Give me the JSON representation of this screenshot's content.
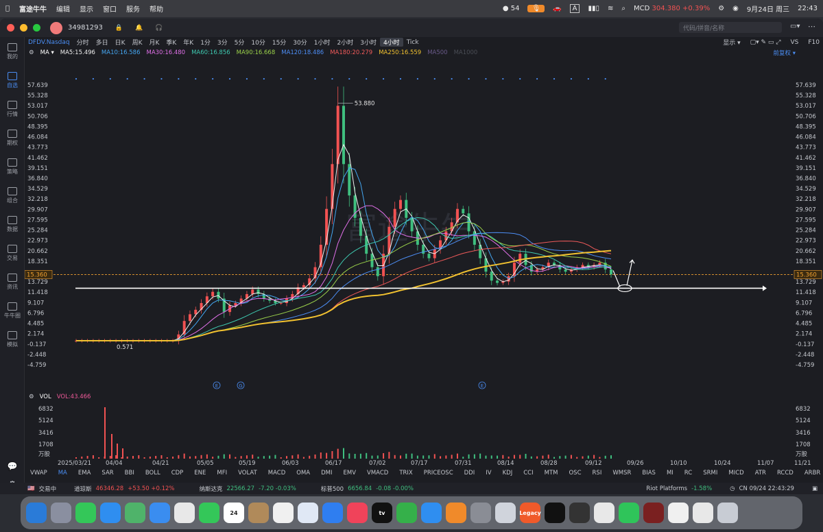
{
  "menubar": {
    "apple_icon": "apple-icon",
    "app_name": "富途牛牛",
    "items": [
      "编辑",
      "显示",
      "窗口",
      "服务",
      "帮助"
    ],
    "wechat_count": "54",
    "stock": "MCD",
    "stock_price": "304.380",
    "stock_change": "+0.39%",
    "date": "9月24日 周三",
    "time": "22:43"
  },
  "window": {
    "account": "34981293",
    "search_placeholder": "代码/拼音/名称"
  },
  "sidebar": [
    {
      "label": "我的",
      "icon": "user-icon"
    },
    {
      "label": "自选",
      "icon": "watchlist-icon"
    },
    {
      "label": "行情",
      "icon": "market-icon"
    },
    {
      "label": "期权",
      "icon": "options-icon"
    },
    {
      "label": "策略",
      "icon": "strategy-icon"
    },
    {
      "label": "组合",
      "icon": "portfolio-icon"
    },
    {
      "label": "数据",
      "icon": "data-icon"
    },
    {
      "label": "交易",
      "icon": "trade-icon"
    },
    {
      "label": "资讯",
      "icon": "news-icon"
    },
    {
      "label": "牛牛圈",
      "icon": "community-icon"
    },
    {
      "label": "模拟",
      "icon": "simulate-icon"
    }
  ],
  "toolbar": {
    "symbol": "DFDV.Nasdaq",
    "timeframes": [
      "分时",
      "多日",
      "日K",
      "周K",
      "月K",
      "季K",
      "年K",
      "1分",
      "3分",
      "5分",
      "10分",
      "15分",
      "30分",
      "1小时",
      "2小时",
      "3小时",
      "4小时",
      "Tick"
    ],
    "selected": "4小时",
    "display": "显示",
    "adjust": "前复权",
    "vs": "VS",
    "f10": "F10"
  },
  "ma": [
    {
      "label": "MA5:15.496",
      "color": "#f0f0f0"
    },
    {
      "label": "MA10:16.586",
      "color": "#45a7f2"
    },
    {
      "label": "MA30:16.480",
      "color": "#e070e8"
    },
    {
      "label": "MA60:16.856",
      "color": "#3ec9b0"
    },
    {
      "label": "MA90:16.668",
      "color": "#9bd24a"
    },
    {
      "label": "MA120:18.486",
      "color": "#4d8ef5"
    },
    {
      "label": "MA180:20.279",
      "color": "#f05a5a"
    },
    {
      "label": "MA250:16.559",
      "color": "#f2c230"
    },
    {
      "label": "MA500",
      "color": "#6a5a8a"
    },
    {
      "label": "MA1000",
      "color": "#4a4d55"
    }
  ],
  "chart_data": {
    "type": "candlestick",
    "symbol": "DFDV.Nasdaq",
    "y_ticks": [
      "57.639",
      "55.328",
      "53.017",
      "50.706",
      "48.395",
      "46.084",
      "43.773",
      "41.462",
      "39.151",
      "36.840",
      "34.529",
      "32.218",
      "29.907",
      "27.595",
      "25.284",
      "22.973",
      "20.662",
      "18.351",
      "15.360",
      "13.729",
      "11.418",
      "9.107",
      "6.796",
      "4.485",
      "2.174",
      "-0.137",
      "-2.448",
      "-4.759"
    ],
    "ylim": [
      -4.759,
      57.639
    ],
    "x_ticks": [
      "2025/03/21",
      "04/04",
      "04/21",
      "05/05",
      "05/19",
      "06/03",
      "06/17",
      "07/02",
      "07/17",
      "07/31",
      "08/14",
      "08/28",
      "09/12",
      "09/26",
      "10/10",
      "10/24",
      "11/07",
      "11/21"
    ],
    "high_label": "53.880",
    "low_label": "0.571",
    "current_price": "15.360",
    "event_markers": [
      "E",
      "G",
      "E"
    ],
    "support_level": 12.3,
    "close_path": [
      0.6,
      0.6,
      0.6,
      0.6,
      0.6,
      0.6,
      0.6,
      0.6,
      0.6,
      0.6,
      0.6,
      0.6,
      0.6,
      0.6,
      0.6,
      0.6,
      0.6,
      0.6,
      2.0,
      5.0,
      6.5,
      7.5,
      9.0,
      10.5,
      11.5,
      10.0,
      7.0,
      8.5,
      9.0,
      10.0,
      11.0,
      12.0,
      11.0,
      10.0,
      9.5,
      9.0,
      9.0,
      10.0,
      11.0,
      12.5,
      13.0,
      14.5,
      17.0,
      22.0,
      30.0,
      40.0,
      53.0,
      40.0,
      33.0,
      28.0,
      24.0,
      20.0,
      17.0,
      15.0,
      20.0,
      26.0,
      30.0,
      32.0,
      28.0,
      25.0,
      22.0,
      20.0,
      19.0,
      21.0,
      23.0,
      25.0,
      27.0,
      30.0,
      29.0,
      25.0,
      22.0,
      19.0,
      16.0,
      14.0,
      13.5,
      13.8,
      15.0,
      18.0,
      20.0,
      17.5,
      16.0,
      16.5,
      17.0,
      18.0,
      17.5,
      16.5,
      16.0,
      16.5,
      17.0,
      17.5,
      17.0,
      17.5,
      18.0,
      16.5,
      15.4
    ],
    "volume": {
      "label": "VOL",
      "value": "VOL:43.466",
      "y_ticks": [
        "6832",
        "5124",
        "3416",
        "1708",
        "万股"
      ],
      "spikes": [
        7500,
        3600,
        2200,
        1500
      ]
    }
  },
  "annotations": [
    "white-support-line",
    "down-arrow",
    "up-arrow",
    "circle-mark"
  ],
  "indicators": [
    "VWAP",
    "MA",
    "EMA",
    "SAR",
    "BBI",
    "BOLL",
    "CDP",
    "ENE",
    "MFI",
    "VOLAT",
    "MACD",
    "OMA",
    "DMI",
    "EMV",
    "VMACD",
    "TRIX",
    "PRICEOSC",
    "DDI",
    "IV",
    "KDJ",
    "CCI",
    "MTM",
    "OSC",
    "RSI",
    "WMSR",
    "BIAS",
    "MI",
    "RC",
    "SRMI",
    "MICD",
    "ATR",
    "RCCD",
    "ARBR"
  ],
  "indicator_selected": "MA",
  "indicator_manage": "指标管理",
  "timeshare": "时段",
  "status": {
    "market": "交易中",
    "dji": "道琼斯",
    "dji_val": "46346.28",
    "dji_chg": "+53.50 +0.12%",
    "nasdaq": "纳斯达克",
    "nasdaq_val": "22566.27",
    "nasdaq_chg": "-7.20 -0.03%",
    "sp": "标普500",
    "sp_val": "6656.84",
    "sp_chg": "-0.08 -0.00%",
    "riot": "Riot Platforms",
    "riot_chg": "-1.58%",
    "clock": "CN 09/24 22:43:29"
  },
  "dock": [
    {
      "n": "finder-icon",
      "c": "#2a7bd8"
    },
    {
      "n": "launchpad-icon",
      "c": "#8a8fa0"
    },
    {
      "n": "messages-icon",
      "c": "#34c759"
    },
    {
      "n": "safari-icon",
      "c": "#2f8ef0"
    },
    {
      "n": "maps-icon",
      "c": "#4fb36a"
    },
    {
      "n": "mail-icon",
      "c": "#3a8df0"
    },
    {
      "n": "photos-icon",
      "c": "#e8e8e8"
    },
    {
      "n": "facetime-icon",
      "c": "#34c759"
    },
    {
      "n": "calendar-icon",
      "c": "#ffffff",
      "t": "24"
    },
    {
      "n": "contacts-icon",
      "c": "#b08a5a"
    },
    {
      "n": "reminders-icon",
      "c": "#f0f0f0"
    },
    {
      "n": "freeform-icon",
      "c": "#e0e8f5"
    },
    {
      "n": "keynote-icon",
      "c": "#2f7ef0"
    },
    {
      "n": "music-icon",
      "c": "#f0435a"
    },
    {
      "n": "tv-icon",
      "c": "#111111",
      "t": "tv"
    },
    {
      "n": "numbers-icon",
      "c": "#35b04a"
    },
    {
      "n": "appstore-icon",
      "c": "#2f8ef0"
    },
    {
      "n": "pages-icon",
      "c": "#f08a2a"
    },
    {
      "n": "settings-icon",
      "c": "#8a8d95"
    },
    {
      "n": "iphone-mirror-icon",
      "c": "#d0d4dc"
    },
    {
      "n": "futu-legacy-icon",
      "c": "#f05a2a",
      "t": "Legacy"
    },
    {
      "n": "robinhood-icon",
      "c": "#111111"
    },
    {
      "n": "guitar-icon",
      "c": "#333333"
    },
    {
      "n": "draw-icon",
      "c": "#e8e8e8"
    },
    {
      "n": "wechat-icon",
      "c": "#2fc45a"
    },
    {
      "n": "window-thumb-1",
      "c": "#7a2020"
    },
    {
      "n": "window-thumb-2",
      "c": "#f0f0f0"
    },
    {
      "n": "window-thumb-3",
      "c": "#e8e8e8"
    },
    {
      "n": "trash-icon",
      "c": "#c8ccd4"
    }
  ]
}
